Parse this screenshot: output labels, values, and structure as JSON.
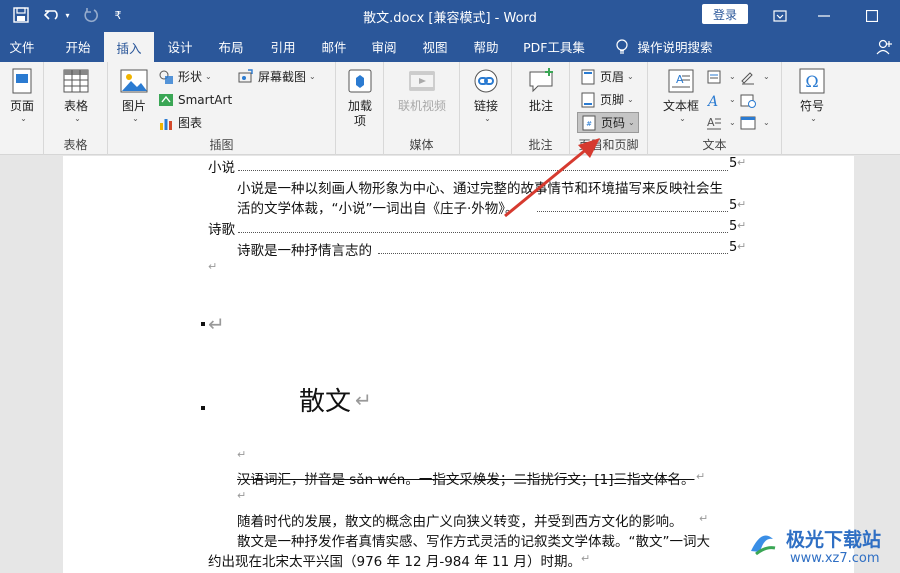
{
  "window": {
    "title": "散文.docx [兼容模式]  -  Word",
    "login_label": "登录"
  },
  "tabs": [
    "文件",
    "开始",
    "插入",
    "设计",
    "布局",
    "引用",
    "邮件",
    "审阅",
    "视图",
    "帮助",
    "PDF工具集",
    "操作说明搜索"
  ],
  "active_tab": "插入",
  "ribbon": {
    "page_label": "页面",
    "table_label": "表格",
    "table_group": "表格",
    "picture_label": "图片",
    "shapes_label": "形状",
    "smartart_label": "SmartArt",
    "chart_label": "图表",
    "screenshot_label": "屏幕截图",
    "illustrations_group": "插图",
    "addins_label": "加载\n项",
    "online_video_label": "联机视频",
    "media_group": "媒体",
    "link_label": "链接",
    "comment_label": "批注",
    "comment_group": "批注",
    "header_label": "页眉",
    "footer_label": "页脚",
    "pagenum_label": "页码",
    "hf_group": "页眉和页脚",
    "textbox_label": "文本框",
    "text_group": "文本",
    "symbol_label": "符号"
  },
  "document": {
    "toc1_title": "小说",
    "toc1_page": "5",
    "toc1_sub_line1": "小说是一种以刻画人物形象为中心、通过完整的故事情节和环境描写来反映社会生",
    "toc1_sub_line2": "活的文学体裁，“小说”一词出自《庄子·外物》。",
    "toc1_sub_page": "5",
    "toc2_title": "诗歌",
    "toc2_page": "5",
    "toc2_sub": "诗歌是一种抒情言志的",
    "toc2_sub_page": "5",
    "heading": "散文",
    "strike_line": "汉语词汇，拼音是 sǎn wén。一指文采焕发；二指扰行文；[1]三指文体名。",
    "para1": "随着时代的发展，散文的概念由广义向狭义转变，并受到西方文化的影响。",
    "para2_line1": "散文是一种抒发作者真情实感、写作方式灵活的记叙类文学体裁。“散文”一词大",
    "para2_line2": "约出现在北宋太平兴国（976 年 12 月-984 年 11 月）时期。"
  },
  "watermark": {
    "brand": "极光下载站",
    "url": "www.xz7.com"
  },
  "colors": {
    "titlebar": "#2b579a",
    "arrow": "#d63a2f"
  }
}
